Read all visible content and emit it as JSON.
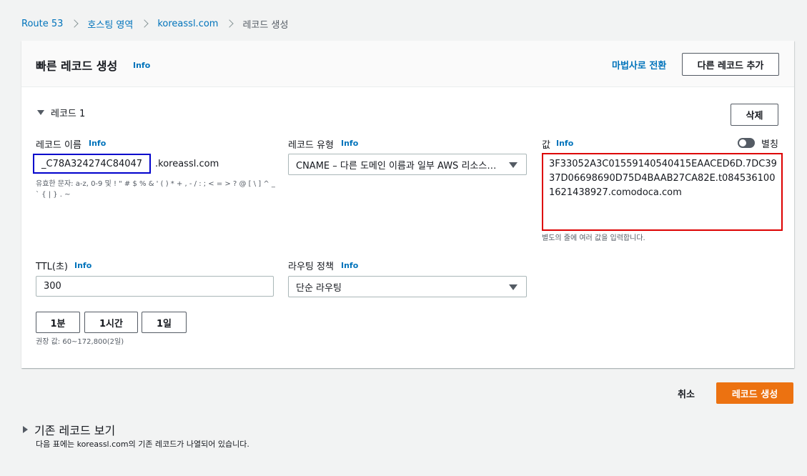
{
  "breadcrumb": {
    "items": [
      "Route 53",
      "호스팅 영역",
      "koreassl.com"
    ],
    "current": "레코드 생성"
  },
  "panel": {
    "title": "빠른 레코드 생성",
    "info": "Info",
    "wizard_link": "마법사로 전환",
    "add_record_button": "다른 레코드 추가"
  },
  "record": {
    "section_label": "레코드 1",
    "delete_button": "삭제",
    "name": {
      "label": "레코드 이름",
      "info": "Info",
      "value": "_C78A324274C84047",
      "suffix": ".koreassl.com",
      "hint": "유효한 문자: a-z, 0-9 및 ! \" # $ % & ' ( ) * + , - / : ; < = > ? @ [ \\ ] ^ _ ` { | } . ~"
    },
    "type": {
      "label": "레코드 유형",
      "info": "Info",
      "value": "CNAME – 다른 도메인 이름과 일부 AWS 리소스로..."
    },
    "value": {
      "label": "값",
      "info": "Info",
      "alias_label": "별칭",
      "text": "3F33052A3C01559140540415EAACED6D.7DC3937D06698690D75D4BAAB27CA82E.t0845361001621438927.comodoca.com",
      "hint": "별도의 줄에 여러 값을 입력합니다."
    },
    "ttl": {
      "label": "TTL(초)",
      "info": "Info",
      "value": "300",
      "presets": [
        "1분",
        "1시간",
        "1일"
      ],
      "hint": "권장 값: 60~172,800(2일)"
    },
    "routing": {
      "label": "라우팅 정책",
      "info": "Info",
      "value": "단순 라우팅"
    }
  },
  "footer": {
    "cancel": "취소",
    "create": "레코드 생성"
  },
  "existing": {
    "title": "기존 레코드 보기",
    "desc": "다음 표에는 koreassl.com의 기존 레코드가 나열되어 있습니다."
  },
  "colors": {
    "link": "#0073bb",
    "primary": "#ec7211",
    "highlight_blue": "#0000cc",
    "highlight_red": "#dd0000"
  }
}
